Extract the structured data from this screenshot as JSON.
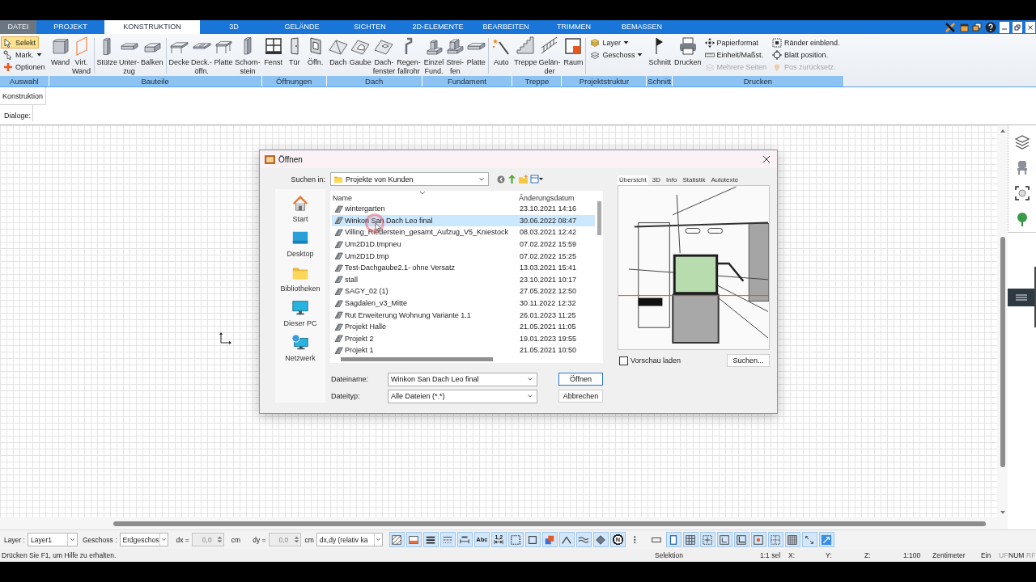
{
  "tabs": [
    {
      "label": "DATEI",
      "kind": "menu",
      "selected": false
    },
    {
      "label": "PROJEKT",
      "kind": "tab",
      "selected": false
    },
    {
      "label": "KONSTRUKTION",
      "kind": "tab",
      "selected": true
    },
    {
      "label": "3D",
      "kind": "tab",
      "selected": false
    },
    {
      "label": "GELÄNDE",
      "kind": "tab",
      "selected": false
    },
    {
      "label": "SICHTEN",
      "kind": "tab",
      "selected": false
    },
    {
      "label": "2D-ELEMENTE",
      "kind": "tab",
      "selected": false
    },
    {
      "label": "BEARBEITEN",
      "kind": "tab",
      "selected": false
    },
    {
      "label": "TRIMMEN",
      "kind": "tab",
      "selected": false
    },
    {
      "label": "BEMASSEN",
      "kind": "tab",
      "selected": false
    }
  ],
  "ribbon": {
    "groups": [
      {
        "label": "Auswahl",
        "sections": [
          {
            "kind": "small",
            "tools": [
              {
                "label": "Selekt",
                "active": true,
                "dropdown": false
              },
              {
                "label": "Mark.",
                "active": false,
                "dropdown": true
              },
              {
                "label": "Optionen",
                "active": false,
                "dropdown": false
              }
            ]
          }
        ]
      },
      {
        "label": "Bauteile",
        "sections": [
          {
            "kind": "large",
            "tools": [
              {
                "label": "Wand"
              },
              {
                "label": "Virt.\nWand"
              }
            ]
          },
          {
            "kind": "large",
            "divider": true,
            "tools": [
              {
                "label": "Stütze"
              },
              {
                "label": "Unter-\nzug"
              },
              {
                "label": "Balken"
              }
            ]
          },
          {
            "kind": "large",
            "divider": true,
            "tools": [
              {
                "label": "Decke"
              },
              {
                "label": "Deck.-\nöffn."
              },
              {
                "label": "Platte"
              },
              {
                "label": "Schorn-\nstein"
              }
            ]
          }
        ]
      },
      {
        "label": "Öffnungen",
        "sections": [
          {
            "kind": "large",
            "tools": [
              {
                "label": "Fenst"
              },
              {
                "label": "Tür"
              },
              {
                "label": "Öffn."
              }
            ]
          }
        ]
      },
      {
        "label": "Dach",
        "sections": [
          {
            "kind": "large",
            "tools": [
              {
                "label": "Dach"
              },
              {
                "label": "Gaube"
              },
              {
                "label": "Dach-\nfenster"
              },
              {
                "label": "Regen-\nfallrohr"
              }
            ]
          }
        ]
      },
      {
        "label": "Fundament",
        "sections": [
          {
            "kind": "large",
            "tools": [
              {
                "label": "Einzel\nFund."
              },
              {
                "label": "Strei-\nfen"
              },
              {
                "label": "Platte"
              }
            ]
          },
          {
            "kind": "large",
            "divider": true,
            "tools": [
              {
                "label": "Auto"
              }
            ]
          }
        ]
      },
      {
        "label": "Treppe",
        "sections": [
          {
            "kind": "large",
            "tools": [
              {
                "label": "Treppe"
              },
              {
                "label": "Gelän-\nder"
              }
            ]
          }
        ]
      },
      {
        "label": "Projektstruktur",
        "sections": [
          {
            "kind": "large",
            "tools": [
              {
                "label": "Raum"
              }
            ]
          },
          {
            "kind": "small",
            "divider": true,
            "tools": [
              {
                "label": "Layer",
                "dropdown": true
              },
              {
                "label": "Geschoss",
                "dropdown": true
              }
            ]
          }
        ]
      },
      {
        "label": "Schnitt",
        "sections": [
          {
            "kind": "large",
            "tools": [
              {
                "label": "Schnitt"
              }
            ]
          }
        ]
      },
      {
        "label": "Drucken",
        "sections": [
          {
            "kind": "large",
            "tools": [
              {
                "label": "Drucken"
              }
            ]
          },
          {
            "kind": "small",
            "tools": [
              {
                "label": "Papierformat",
                "disabled": false
              },
              {
                "label": "Einheit/Maßst.",
                "disabled": false
              },
              {
                "label": "Mehrere Seiten",
                "disabled": true
              }
            ]
          },
          {
            "kind": "small",
            "tools": [
              {
                "label": "Ränder einblend.",
                "disabled": false
              },
              {
                "label": "Blatt position.",
                "disabled": false
              },
              {
                "label": "Pos zurücksetz.",
                "disabled": true
              }
            ]
          }
        ]
      }
    ]
  },
  "panel_tab": {
    "label": "Konstruktion"
  },
  "dialogs_bar": {
    "label": "Dialoge:"
  },
  "dialog": {
    "title": "Öffnen",
    "look_in": {
      "label": "Suchen in:",
      "value": "Projekte von Kunden"
    },
    "places": [
      {
        "label": "Start"
      },
      {
        "label": "Desktop"
      },
      {
        "label": "Bibliotheken"
      },
      {
        "label": "Dieser PC"
      },
      {
        "label": "Netzwerk"
      }
    ],
    "file_list": {
      "columns": [
        "Name",
        "Änderungsdatum"
      ],
      "rows": [
        {
          "name": "wintergarten",
          "date": "23.10.2021 14:16",
          "selected": false
        },
        {
          "name": "Winkon San Dach Leo final",
          "date": "30.06.2022 08:47",
          "selected": true
        },
        {
          "name": "Villing_Riederstein_gesamt_Aufzug_V5_Kniestock",
          "date": "08.03.2021 12:42",
          "selected": false
        },
        {
          "name": "Um2D1D.tmpneu",
          "date": "07.02.2022 15:59",
          "selected": false
        },
        {
          "name": "Um2D1D.tmp",
          "date": "07.02.2022 15:25",
          "selected": false
        },
        {
          "name": "Test-Dachgaube2.1- ohne Versatz",
          "date": "13.03.2021 15:41",
          "selected": false
        },
        {
          "name": "stall",
          "date": "23.10.2021 10:17",
          "selected": false
        },
        {
          "name": "SAGY_02 (1)",
          "date": "27.05.2022 12:50",
          "selected": false
        },
        {
          "name": "Sagdalen_v3_Mitte",
          "date": "30.11.2022 12:32",
          "selected": false
        },
        {
          "name": "Rut Erweiterung Wohnung Variante 1.1",
          "date": "26.01.2023 11:25",
          "selected": false
        },
        {
          "name": "Projekt Halle",
          "date": "21.05.2021 11:05",
          "selected": false
        },
        {
          "name": "Projekt 2",
          "date": "19.01.2023 19:55",
          "selected": false
        },
        {
          "name": "Projekt 1",
          "date": "21.05.2021 10:50",
          "selected": false
        }
      ]
    },
    "file_name": {
      "label": "Dateiname:",
      "value": "Winkon San Dach Leo final"
    },
    "file_type": {
      "label": "Dateityp:",
      "value": "Alle Dateien (*.*)"
    },
    "buttons": [
      {
        "label": "Öffnen",
        "default": true
      },
      {
        "label": "Abbrechen",
        "default": false
      }
    ],
    "preview": {
      "tabs": [
        {
          "label": "Übersicht",
          "selected": true
        },
        {
          "label": "3D",
          "selected": false
        },
        {
          "label": "Info",
          "selected": false
        },
        {
          "label": "Statistik",
          "selected": false
        },
        {
          "label": "Autotexte",
          "selected": false
        }
      ],
      "load_preview": {
        "label": "Vorschau laden",
        "checked": false
      },
      "search_button": "Suchen..."
    }
  },
  "toolbar": {
    "layer": {
      "label": "Layer :",
      "value": "Layer1"
    },
    "floor": {
      "label": "Geschoss :",
      "value": "Erdgeschos"
    },
    "dx": {
      "label": "dx =",
      "value": "0,0",
      "unit": "cm",
      "disabled": true
    },
    "dy": {
      "label": "dy =",
      "value": "0,0",
      "unit": "cm",
      "disabled": true
    },
    "mode": {
      "value": "dx,dy (relativ ka"
    },
    "tool_groups": [
      [
        {
          "kind": "icon",
          "on": true
        },
        {
          "kind": "icon",
          "on": true
        },
        {
          "kind": "icon",
          "on": true
        },
        {
          "kind": "icon",
          "on": true
        },
        {
          "kind": "icon",
          "on": true
        },
        {
          "kind": "text",
          "label": "Abc",
          "on": true
        },
        {
          "kind": "measure",
          "label": "1,2",
          "on": true
        },
        {
          "kind": "icon",
          "on": true
        },
        {
          "kind": "icon",
          "on": true
        },
        {
          "kind": "icon",
          "on": true
        },
        {
          "kind": "icon",
          "on": true
        },
        {
          "kind": "icon",
          "on": true
        },
        {
          "kind": "icon",
          "on": true
        },
        {
          "kind": "circle",
          "label": "N",
          "on": true
        },
        {
          "kind": "icon",
          "on": false
        }
      ],
      [
        {
          "kind": "icon",
          "on": false
        },
        {
          "kind": "icon",
          "on": true
        },
        {
          "kind": "icon",
          "on": true
        },
        {
          "kind": "icon",
          "on": true
        },
        {
          "kind": "icon",
          "on": true
        },
        {
          "kind": "icon",
          "on": true
        },
        {
          "kind": "icon",
          "on": true
        },
        {
          "kind": "icon",
          "on": true
        },
        {
          "kind": "icon",
          "on": true
        },
        {
          "kind": "icon",
          "on": true
        },
        {
          "kind": "icon",
          "on": true
        }
      ]
    ]
  },
  "status_bar": {
    "message": "Drücken Sie F1, um Hilfe zu erhalten.",
    "panes": [
      {
        "text": "Selektion",
        "enabled": true
      },
      {
        "text": "1:1 sel",
        "enabled": true
      },
      {
        "text": "X:",
        "enabled": true
      },
      {
        "text": "Y:",
        "enabled": true
      },
      {
        "text": "Z:",
        "enabled": true
      },
      {
        "text": "1:100",
        "enabled": true
      },
      {
        "text": "Zentimeter",
        "enabled": true
      },
      {
        "text": "Ein",
        "enabled": true
      },
      {
        "text": "UF",
        "enabled": false
      },
      {
        "text": "NUM",
        "enabled": true
      },
      {
        "text": "RF",
        "enabled": false
      }
    ]
  }
}
